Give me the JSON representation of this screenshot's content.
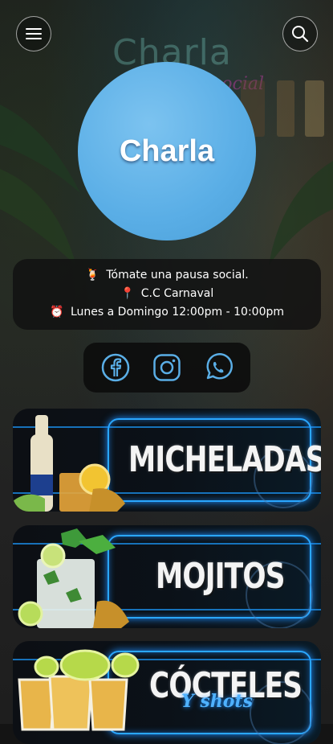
{
  "background": {
    "sign_text": "Charla",
    "sign_sub": "social"
  },
  "header": {
    "menu_icon": "hamburger-menu-icon",
    "search_icon": "search-icon"
  },
  "logo": {
    "text": "Charla"
  },
  "info": {
    "tagline_icon": "🍹",
    "tagline": "Tómate una pausa social.",
    "location_icon": "📍",
    "location": "C.C Carnaval",
    "hours_icon": "⏰",
    "hours": "Lunes a Domingo 12:00pm - 10:00pm"
  },
  "social": {
    "facebook": "facebook-icon",
    "instagram": "instagram-icon",
    "whatsapp": "whatsapp-icon"
  },
  "categories": [
    {
      "title": "MICHELADAS",
      "subtitle": ""
    },
    {
      "title": "MOJITOS",
      "subtitle": ""
    },
    {
      "title": "CÓCTELES",
      "subtitle": "Y shots"
    }
  ],
  "colors": {
    "accent": "#2aa7ff",
    "logo_blue": "#5aaee6",
    "card_bg": "#0b1118"
  }
}
